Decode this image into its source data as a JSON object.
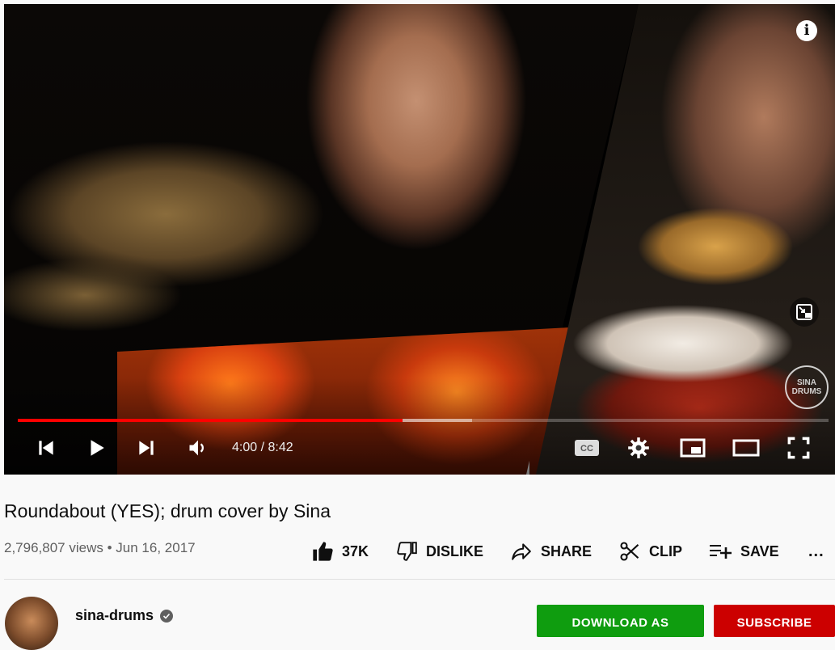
{
  "player": {
    "progress_fraction": 0.475,
    "buffered_fraction": 0.56,
    "time_display": "4:00 / 8:42",
    "info_icon": "i",
    "watermark_text": "SINA DRUMS",
    "icons": [
      "prev-icon",
      "play-icon",
      "next-icon",
      "volume-icon",
      "cc-icon",
      "settings-icon",
      "miniplayer-icon",
      "theater-icon",
      "fullscreen-icon",
      "info-icon"
    ]
  },
  "video": {
    "title": "Roundabout (YES); drum cover by Sina",
    "views": "2,796,807 views",
    "separator": "•",
    "date": "Jun 16, 2017"
  },
  "actions": {
    "like_count": "37K",
    "dislike_label": "DISLIKE",
    "share_label": "SHARE",
    "clip_label": "CLIP",
    "save_label": "SAVE",
    "more_label": "..."
  },
  "channel": {
    "name": "sina-drums",
    "download_label": "DOWNLOAD AS",
    "subscribe_label": "SUBSCRIBE"
  },
  "colors": {
    "progress": "#ff0000",
    "download": "#0f9d0f",
    "subscribe": "#cc0000"
  }
}
